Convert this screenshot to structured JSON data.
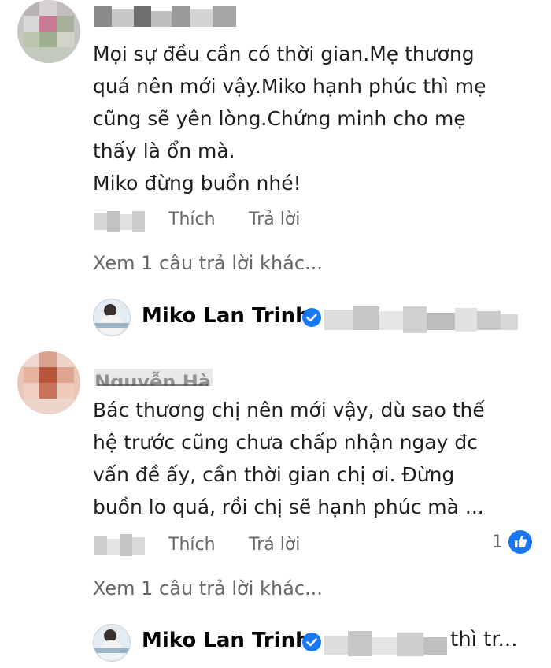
{
  "comments": [
    {
      "text_lines": [
        "Mọi sự đều cần có thời gian.Mẹ thương",
        "quá nên mới vậy.Miko hạnh phúc thì mẹ",
        "cũng sẽ yên lòng.Chứng minh cho mẹ",
        "thấy là ổn mà.",
        "Miko đừng buồn nhé!"
      ],
      "like_label": "Thích",
      "reply_label": "Trả lời",
      "view_more": "Xem 1 câu trả lời khác...",
      "reply_preview": {
        "author": "Miko Lan Trinh",
        "snippet": ""
      }
    },
    {
      "author_partial": "Nguyễn Hà",
      "text_lines": [
        "Bác thương chị nên mới vậy, dù sao thế",
        "hệ trước cũng chưa chấp nhận ngay đc",
        "vấn đề ấy, cần thời gian chị ơi. Đừng",
        "buồn lo quá, rồi chị sẽ hạnh phúc mà ..."
      ],
      "like_label": "Thích",
      "reply_label": "Trả lời",
      "reaction_count": "1",
      "reaction_icon": "like-thumb-icon",
      "view_more": "Xem 1 câu trả lời khác...",
      "reply_preview": {
        "author": "Miko Lan Trinh",
        "snippet": "thì tr..."
      }
    }
  ],
  "colors": {
    "accent": "#1877f2",
    "muted": "#65676b",
    "text": "#1c1e21"
  }
}
